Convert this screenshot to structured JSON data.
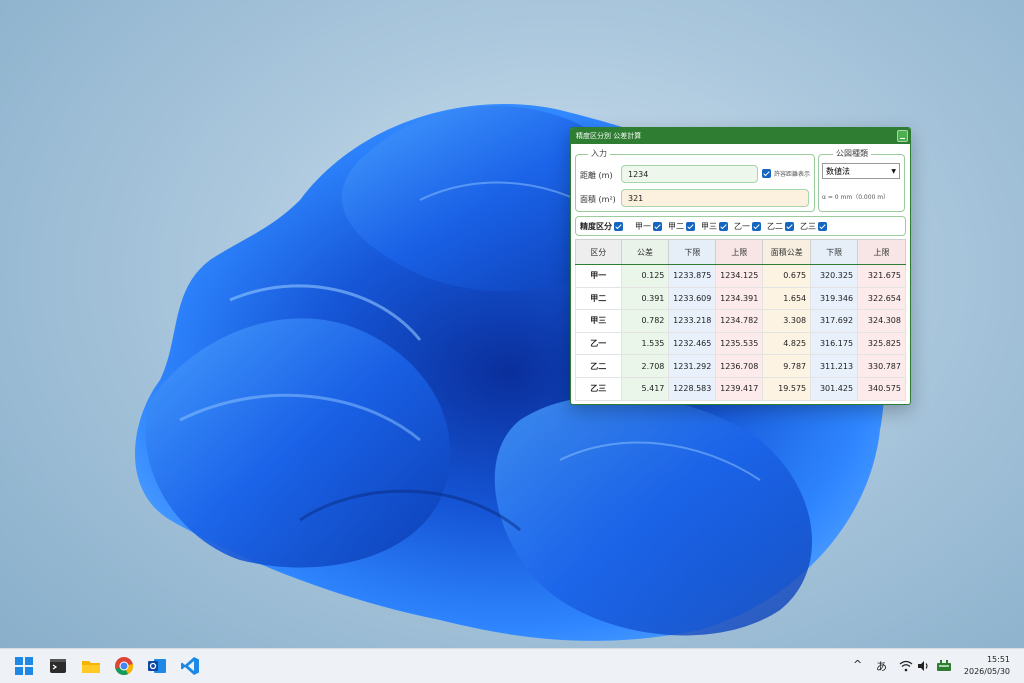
{
  "window": {
    "title": "精度区分別 公差計算"
  },
  "input_group": {
    "legend": "入力",
    "distance_label": "距離 (m)",
    "distance_value": "1234",
    "show_tolerance_label": "許容距離表示",
    "area_label": "面積 (m²)",
    "area_value": "321"
  },
  "map_type": {
    "legend": "公図種類",
    "selected": "数値法",
    "note": "α = 0 mm（0.000 m）"
  },
  "precision": {
    "label": "精度区分",
    "items": [
      "甲一",
      "甲二",
      "甲三",
      "乙一",
      "乙二",
      "乙三"
    ]
  },
  "table": {
    "headers": [
      "区分",
      "公差",
      "下限",
      "上限",
      "面積公差",
      "下限",
      "上限"
    ],
    "rows": [
      [
        "甲一",
        "0.125",
        "1233.875",
        "1234.125",
        "0.675",
        "320.325",
        "321.675"
      ],
      [
        "甲二",
        "0.391",
        "1233.609",
        "1234.391",
        "1.654",
        "319.346",
        "322.654"
      ],
      [
        "甲三",
        "0.782",
        "1233.218",
        "1234.782",
        "3.308",
        "317.692",
        "324.308"
      ],
      [
        "乙一",
        "1.535",
        "1232.465",
        "1235.535",
        "4.825",
        "316.175",
        "325.825"
      ],
      [
        "乙二",
        "2.708",
        "1231.292",
        "1236.708",
        "9.787",
        "311.213",
        "330.787"
      ],
      [
        "乙三",
        "5.417",
        "1228.583",
        "1239.417",
        "19.575",
        "301.425",
        "340.575"
      ]
    ]
  },
  "taskbar": {
    "apps": [
      "start-icon",
      "terminal-icon",
      "file-explorer-icon",
      "chrome-icon",
      "outlook-icon",
      "vscode-icon"
    ],
    "ime": "あ",
    "time": "15:51",
    "date": "2026/05/30"
  },
  "colors": {
    "accent": "#2e7d32",
    "checkbox": "#1565c0",
    "bloom": "#1a5fe0"
  }
}
